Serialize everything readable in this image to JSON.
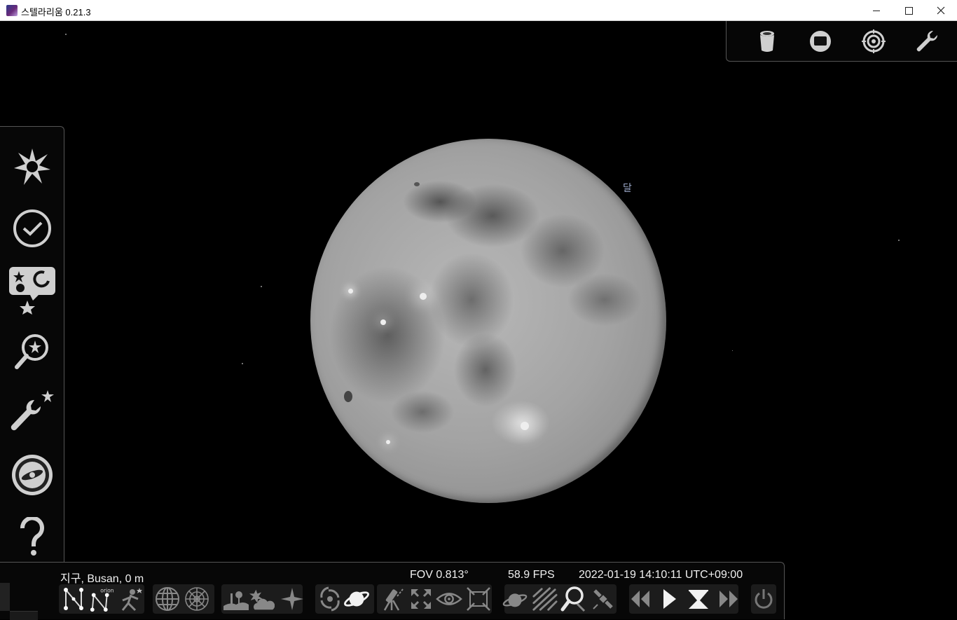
{
  "window": {
    "title": "스텔라리움 0.21.3",
    "controls": {
      "minimize": "minimize",
      "maximize": "maximize",
      "close": "close"
    }
  },
  "sky": {
    "object_label": "달"
  },
  "top_panel": {
    "icons": [
      "telescope-icon",
      "screen-icon",
      "target-icon",
      "wrench-icon"
    ]
  },
  "left_panel": {
    "icons": [
      "location-icon",
      "datetime-icon",
      "sky-view-icon",
      "search-icon",
      "configuration-icon",
      "astro-calc-icon",
      "help-icon"
    ]
  },
  "status_bar": {
    "location": "지구, Busan, 0 m",
    "fov": "FOV 0.813°",
    "fps": "58.9 FPS",
    "datetime": "2022-01-19 14:10:11 UTC+09:00"
  },
  "bottom_toolbar": {
    "groups": [
      [
        "constellation-lines-icon",
        "constellation-names-icon",
        "constellation-art-icon"
      ],
      [
        "equatorial-grid-icon",
        "azimuthal-grid-icon"
      ],
      [
        "ground-icon",
        "atmosphere-icon",
        "cardinal-points-icon"
      ],
      [
        "deep-sky-icon",
        "planets-icon"
      ],
      [
        "equatorial-mount-icon",
        "center-object-icon",
        "night-mode-icon",
        "fullscreen-icon"
      ],
      [
        "planet-labels-icon",
        "meteor-showers-icon",
        "ocular-icon",
        "satellites-icon"
      ],
      [
        "rewind-icon",
        "play-icon",
        "current-time-icon",
        "fast-forward-icon"
      ],
      [
        "quit-icon"
      ]
    ]
  },
  "colors": {
    "background": "#000000",
    "panel_border": "#555555",
    "icon": "#cfcfcf",
    "status_text": "#f0f0f0",
    "object_label": "#9aa7c7"
  }
}
